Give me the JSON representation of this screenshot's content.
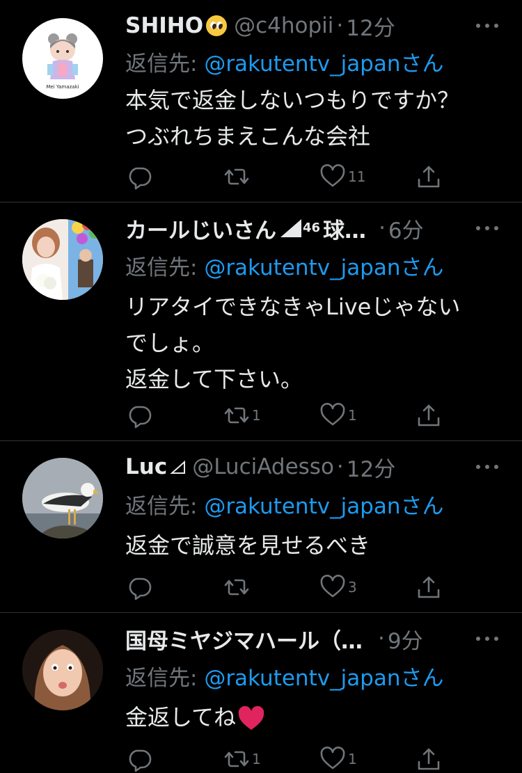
{
  "tweets": [
    {
      "name": "SHIHO",
      "handle": "@c4hopii",
      "dot": "·",
      "time": "12分",
      "reply_prefix": "返信先: ",
      "reply_mention": "@rakutentv_japanさん",
      "lines": [
        "本気で返金しないつもりですか？",
        "つぶれちまえこんな会社"
      ],
      "avatar_text": "Mei Yamazaki",
      "counts": {
        "reply": "",
        "retweet": "",
        "like": "11"
      }
    },
    {
      "name": "カールじいさん",
      "name_sup": "46",
      "name_suffix": "球…",
      "time": "6分",
      "dot": "·",
      "reply_prefix": "返信先: ",
      "reply_mention": "@rakutentv_japanさん",
      "lines": [
        "リアタイできなきゃLiveじゃない",
        "でしょ。",
        "返金して下さい。"
      ],
      "counts": {
        "reply": "",
        "retweet": "1",
        "like": "1"
      }
    },
    {
      "name": "Luc",
      "handle": "@LuciAdesso",
      "dot": "·",
      "time": "12分",
      "reply_prefix": "返信先: ",
      "reply_mention": "@rakutentv_japanさん",
      "lines": [
        "返金で誠意を見せるべき"
      ],
      "counts": {
        "reply": "",
        "retweet": "",
        "like": "3"
      }
    },
    {
      "name": "国母ミヤジマハール（…",
      "dot": "·",
      "time": "9分",
      "reply_prefix": "返信先: ",
      "reply_mention": "@rakutentv_japanさん",
      "lines": [
        "金返してね"
      ],
      "counts": {
        "reply": "",
        "retweet": "1",
        "like": "1"
      }
    }
  ],
  "colors": {
    "background": "#000000",
    "text": "#e7e9ea",
    "muted": "#71767b",
    "link": "#1d9bf0",
    "divider": "#2f3336",
    "heart_emoji": "#e0245e"
  },
  "icons": [
    "reply-icon",
    "retweet-icon",
    "like-icon",
    "share-icon",
    "more-icon",
    "verified-mark-icon"
  ]
}
